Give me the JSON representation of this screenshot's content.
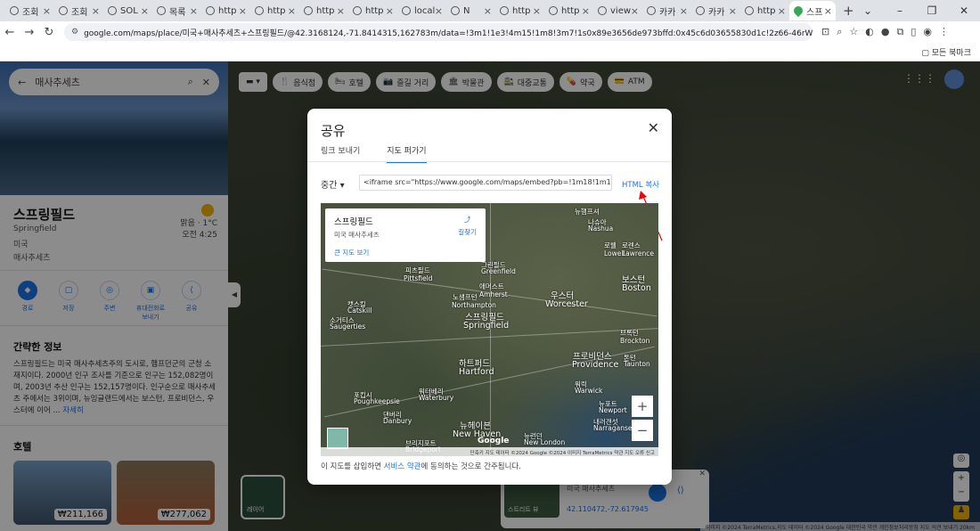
{
  "browser": {
    "tabs": [
      {
        "label": "조회"
      },
      {
        "label": "조회"
      },
      {
        "label": "SOL"
      },
      {
        "label": "목록"
      },
      {
        "label": "http"
      },
      {
        "label": "http"
      },
      {
        "label": "http"
      },
      {
        "label": "http"
      },
      {
        "label": "local"
      },
      {
        "label": "N"
      },
      {
        "label": "http"
      },
      {
        "label": "http"
      },
      {
        "label": "view"
      },
      {
        "label": "카카"
      },
      {
        "label": "카카"
      },
      {
        "label": "http"
      },
      {
        "label": "스프",
        "active": true
      }
    ],
    "url": "google.com/maps/place/미국+매사추세츠+스프링필드/@42.3168124,-71.8414315,162783m/data=!3m1!1e3!4m15!1m8!3m7!1s0x89e3656de973bffd:0x45c6d03655830d1c!2z66-46rWtIOunpOyCrOy2lOyEuOy4oAI3b1!8m2...",
    "bookmarks_label": "모든 북마크"
  },
  "sidebar": {
    "search_value": "매사추세츠",
    "place_name": "스프링필드",
    "place_en": "Springfield",
    "country": "미국",
    "state": "매사추세츠",
    "weather_line1": "맑음 · 1°C",
    "weather_line2": "오전 4:25",
    "actions": [
      "경로",
      "저장",
      "주변",
      "휴대전화로 보내기",
      "공유"
    ],
    "overview_title": "간략한 정보",
    "description": "스프링필드는 미국 매사추세츠주의 도시로, 햄프던군의 군청 소재지이다. 2000년 인구 조사를 기준으로 인구는 152,082명이며, 2003년 추산 인구는 152,157명이다. 인구순으로 매사추세츠 주에서는 3위이며, 뉴잉글랜드에서는 보스턴, 프로비던스, 우스터에 이어 ...",
    "more_link": "자세히",
    "hotels_title": "호텔",
    "hotel_prices": [
      "₩211,166",
      "₩277,062"
    ]
  },
  "map": {
    "chips": [
      "음식점",
      "호텔",
      "즐길 거리",
      "박물관",
      "대중교통",
      "약국",
      "ATM"
    ],
    "layer_label": "레이어",
    "card": {
      "streetview_label": "스트리트 뷰",
      "subtitle": "미국 매사추세츠",
      "coords": "42.110472,-72.617945"
    },
    "attribution": "이미지 ©2024 TerraMetrics,지도 데이터 ©2024 Google   대한민국   약관   개인정보처리방침   지도 의견 보내기   20km"
  },
  "modal": {
    "title": "공유",
    "tab_send": "링크 보내기",
    "tab_embed": "지도 퍼가기",
    "size": "중간",
    "embed_code": "<iframe src=\"https://www.google.com/maps/embed?pb=!1m18!1m12!1m3!1d",
    "copy_html": "HTML 복사",
    "info_name": "스프링필드",
    "info_sub": "미국 매사추세츠",
    "info_link": "큰 지도 보기",
    "info_dir": "길찾기",
    "map_labels": [
      {
        "t": "뉴햄프셔"
      },
      {
        "t": "보스턴",
        "big": true
      },
      {
        "t": "Boston",
        "big": true
      },
      {
        "t": "우스터",
        "big": true
      },
      {
        "t": "Worcester",
        "big": true
      },
      {
        "t": "스프링필드",
        "big": true
      },
      {
        "t": "Springfield",
        "big": true
      },
      {
        "t": "하트퍼드",
        "big": true
      },
      {
        "t": "Hartford",
        "big": true
      },
      {
        "t": "프로비던스",
        "big": true
      },
      {
        "t": "Providence",
        "big": true
      },
      {
        "t": "뉴헤이븐",
        "big": true
      },
      {
        "t": "New Haven",
        "big": true
      },
      {
        "t": "피츠필드"
      },
      {
        "t": "Pittsfield"
      },
      {
        "t": "노샘프턴"
      },
      {
        "t": "Northampton"
      },
      {
        "t": "애머스트"
      },
      {
        "t": "Amherst"
      },
      {
        "t": "그린필드"
      },
      {
        "t": "Greenfield"
      },
      {
        "t": "로웰"
      },
      {
        "t": "Lowell"
      },
      {
        "t": "로렌스"
      },
      {
        "t": "Lawrence"
      },
      {
        "t": "브록턴"
      },
      {
        "t": "Brockton"
      },
      {
        "t": "워터베리"
      },
      {
        "t": "Waterbury"
      },
      {
        "t": "댄버리"
      },
      {
        "t": "Danbury"
      },
      {
        "t": "브리지포트"
      },
      {
        "t": "Bridgeport"
      },
      {
        "t": "뉴런던"
      },
      {
        "t": "New London"
      },
      {
        "t": "포킵시"
      },
      {
        "t": "Poughkeepsie"
      },
      {
        "t": "소거티스"
      },
      {
        "t": "Saugerties"
      },
      {
        "t": "캣스킬"
      },
      {
        "t": "Catskill"
      },
      {
        "t": "워릭"
      },
      {
        "t": "Warwick"
      },
      {
        "t": "뉴포트"
      },
      {
        "t": "Newport"
      },
      {
        "t": "내러갠섯"
      },
      {
        "t": "Narragansett"
      },
      {
        "t": "톤턴"
      },
      {
        "t": "Taunton"
      },
      {
        "t": "나슈아"
      },
      {
        "t": "Nashua"
      }
    ],
    "embed_attr": "단축키   지도 데이터 ©2024 Google ©2024 이미지 TerraMetrics   약관   지도 오류 신고",
    "terms_prefix": "이 지도를 삽입하면 ",
    "terms_link": "서비스 약관",
    "terms_suffix": "에 동의하는 것으로 간주됩니다."
  }
}
